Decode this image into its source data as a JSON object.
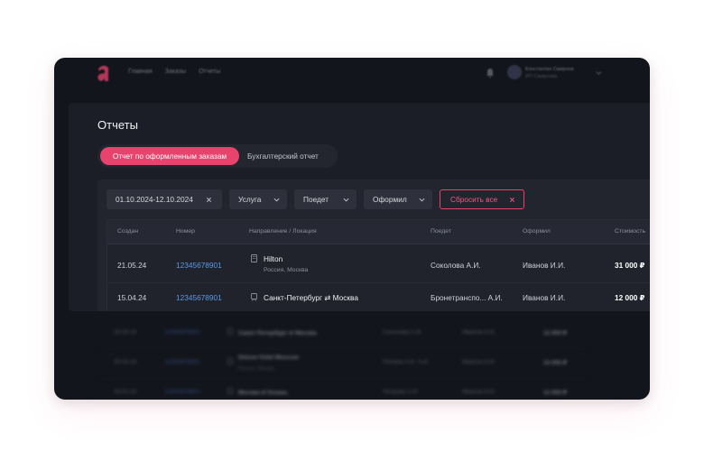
{
  "nav": {
    "links": [
      "Главная",
      "Заказы",
      "Отчеты"
    ],
    "user_name": "Константин Смирнов",
    "user_role": "ИП Смирнова",
    "icons": [
      "bell-icon",
      "chevron-down-icon"
    ]
  },
  "page": {
    "title": "Отчеты"
  },
  "tabs": [
    {
      "label": "Отчет по оформленным заказам",
      "active": true
    },
    {
      "label": "Бухгалтерский отчет",
      "active": false
    }
  ],
  "filters": {
    "date_range": "01.10.2024-12.10.2024",
    "service": "Услуга",
    "traveller": "Поедет",
    "issued_by": "Оформил",
    "reset": "Сбросить все"
  },
  "table": {
    "headers": [
      "Создан",
      "Номер",
      "Направление / Локация",
      "Поедет",
      "Оформил",
      "Стоимость"
    ],
    "rows": [
      {
        "created": "21.05.24",
        "number": "12345678901",
        "direction": "Hilton",
        "location": "Россия, Москва",
        "icon": "hotel-icon",
        "traveller": "Соколова А.И.",
        "issued_by": "Иванов И.И.",
        "cost": "31 000 ₽"
      },
      {
        "created": "15.04.24",
        "number": "12345678901",
        "direction": "Санкт-Петербург ⇄ Москва",
        "location": "",
        "icon": "train-icon",
        "traveller": "Бронетранспо... А.И.",
        "issued_by": "Иванов И.И.",
        "cost": "12 000 ₽"
      }
    ],
    "background_rows": [
      {
        "created": "15.04.24",
        "number": "12345678901",
        "direction": "Санкт-Петербург ⇄ Москва",
        "location": "",
        "traveller": "Соколова А.И.",
        "issued_by": "Иванов И.И.",
        "cost": "12 000 ₽"
      },
      {
        "created": "25.03.24",
        "number": "12345678901",
        "direction": "Deluxe Hotel Moscow",
        "location": "Россия, Москва",
        "traveller": "Попова А.И. А.И.",
        "issued_by": "Иванов И.И.",
        "cost": "15 000 ₽"
      },
      {
        "created": "18.01.24",
        "number": "12345678901",
        "direction": "Москва ⇄ Казань",
        "location": "",
        "traveller": "Петрова А.И.",
        "issued_by": "Иванов И.И.",
        "cost": "12 000 ₽"
      }
    ]
  },
  "colors": {
    "accent": "#e8436d",
    "link": "#5a9be8",
    "background": "#13151c",
    "panel": "#1c1e27"
  }
}
